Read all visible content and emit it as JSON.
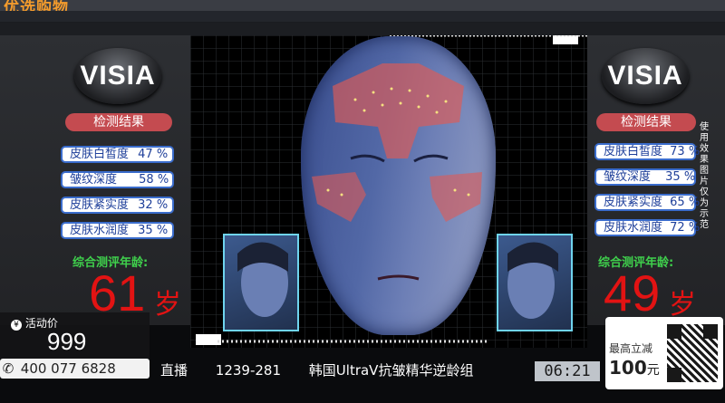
{
  "app": {
    "logo_text": "优选购物"
  },
  "left_panel": {
    "brand": "VISIA",
    "result_title": "检测结果",
    "metrics": [
      {
        "label": "皮肤白皙度",
        "value": "47 %"
      },
      {
        "label": "皱纹深度",
        "value": "58 %"
      },
      {
        "label": "皮肤紧实度",
        "value": "32 %"
      },
      {
        "label": "皮肤水润度",
        "value": "35 %"
      }
    ],
    "age_label": "综合测评年龄:",
    "age_value": "61",
    "age_unit": "岁"
  },
  "right_panel": {
    "brand": "VISIA",
    "result_title": "检测结果",
    "metrics": [
      {
        "label": "皮肤白皙度",
        "value": "73 %"
      },
      {
        "label": "皱纹深度",
        "value": "35 %"
      },
      {
        "label": "皮肤紧实度",
        "value": "65 %"
      },
      {
        "label": "皮肤水润度",
        "value": "72 %"
      }
    ],
    "side_note": "使用效果图片仅为示范",
    "age_label": "综合测评年龄:",
    "age_value": "49",
    "age_unit": "岁"
  },
  "price": {
    "label": "活动价",
    "value": "999"
  },
  "phone": "400 077 6828",
  "ticker": {
    "live": "直播",
    "code": "1239-281",
    "title": "韩国UltraV抗皱精华逆龄组"
  },
  "clock": "06:21",
  "promo": {
    "line1": "最高立减",
    "amount": "100",
    "unit": "元"
  },
  "colors": {
    "accent_red": "#c44b50",
    "metric_blue": "#1e3f9a",
    "age_green": "#3fcf4c",
    "age_red": "#e21313"
  }
}
